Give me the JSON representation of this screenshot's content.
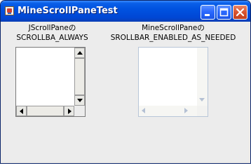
{
  "window": {
    "title": "MineScrollPaneTest",
    "controls": [
      "minimize-icon",
      "maximize-icon",
      "close-icon"
    ],
    "colors": {
      "titlebar": "#0052e0",
      "close_button": "#d9532f",
      "background": "#ececec"
    }
  },
  "panes": [
    {
      "label_line1": "JScrollPaneの",
      "label_line2": "SCROLLBA_ALWAYS",
      "scrollbars": "enabled"
    },
    {
      "label_line1": "MineScrollPaneの",
      "label_line2": "SROLLBAR_ENABLED_AS_NEEDED",
      "scrollbars": "disabled"
    }
  ]
}
